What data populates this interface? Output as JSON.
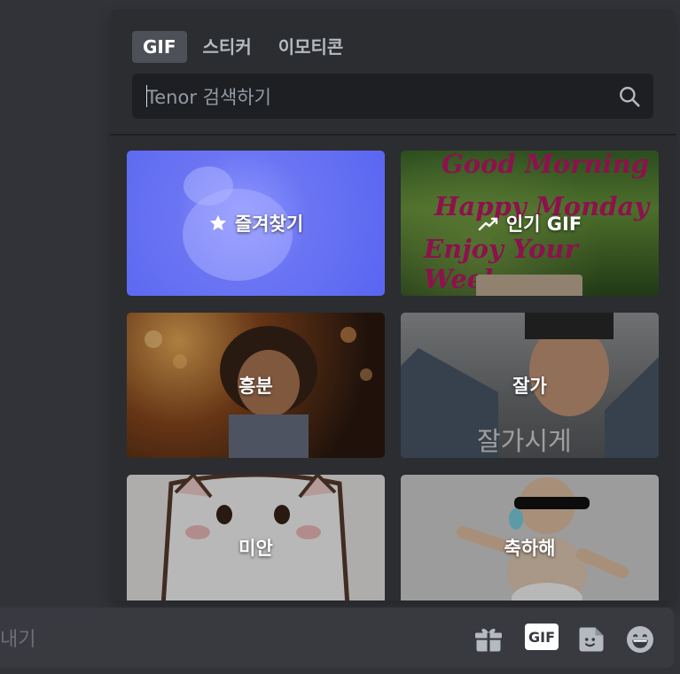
{
  "picker": {
    "tabs": [
      {
        "label": "GIF",
        "active": true
      },
      {
        "label": "스티커",
        "active": false
      },
      {
        "label": "이모티콘",
        "active": false
      }
    ],
    "search": {
      "placeholder": "Tenor 검색하기",
      "icon": "search-icon"
    },
    "categories": [
      {
        "label": "즐겨찾기",
        "icon": "star-icon",
        "color": "#5865f2"
      },
      {
        "label": "인기 GIF",
        "icon": "trending-icon",
        "overlay_lines": [
          "Good Morning",
          "Happy Monday",
          "Enjoy Your Week"
        ]
      },
      {
        "label": "흥분"
      },
      {
        "label": "잘가",
        "overlay_text": "잘가시게"
      },
      {
        "label": "미안"
      },
      {
        "label": "축하해"
      }
    ]
  },
  "chat": {
    "placeholder": "내기",
    "icons": [
      "gift-icon",
      "gif-icon",
      "sticker-icon",
      "emoji-icon"
    ],
    "gif_button_label": "GIF"
  },
  "colors": {
    "accent": "#5865f2",
    "background": "#313338",
    "panel": "#2b2d31"
  }
}
